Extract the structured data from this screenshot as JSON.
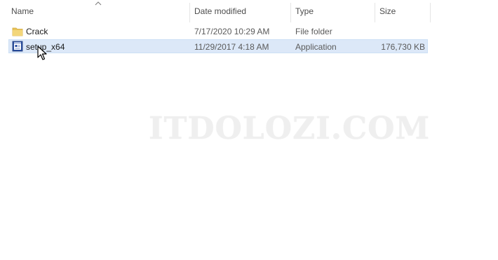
{
  "columns": {
    "name": "Name",
    "date_modified": "Date modified",
    "type": "Type",
    "size": "Size"
  },
  "files": [
    {
      "name": "Crack",
      "date_modified": "7/17/2020 10:29 AM",
      "type": "File folder",
      "size": "",
      "icon": "folder-icon"
    },
    {
      "name": "setup_x64",
      "date_modified": "11/29/2017 4:18 AM",
      "type": "Application",
      "size": "176,730 KB",
      "icon": "application-icon",
      "selected": true
    }
  ],
  "watermark": "ITDOLOZI.COM",
  "colors": {
    "selection": "#dce8f8",
    "folder": "#e8c45c"
  }
}
